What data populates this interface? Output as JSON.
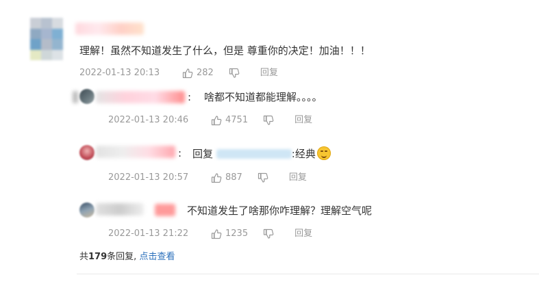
{
  "main_comment": {
    "text": "理解！虽然不知道发生了什么，但是 尊重你的决定！加油！！！",
    "time": "2022-01-13 20:13",
    "likes": "282",
    "reply_label": "回复"
  },
  "replies": [
    {
      "separator": ":",
      "text": "啥都不知道都能理解。。。。",
      "time": "2022-01-13 20:46",
      "likes": "4751",
      "reply_label": "回复"
    },
    {
      "separator": ":",
      "reply_prefix": "回复",
      "text": ":经典",
      "emoji": "smile-emoji",
      "time": "2022-01-13 20:57",
      "likes": "887",
      "reply_label": "回复"
    },
    {
      "text": "不知道发生了啥那你咋理解？理解空气呢",
      "time": "2022-01-13 21:22",
      "likes": "1235",
      "reply_label": "回复"
    }
  ],
  "footer": {
    "prefix": "共",
    "count": "179",
    "suffix": "条回复,",
    "link": "点击查看"
  }
}
